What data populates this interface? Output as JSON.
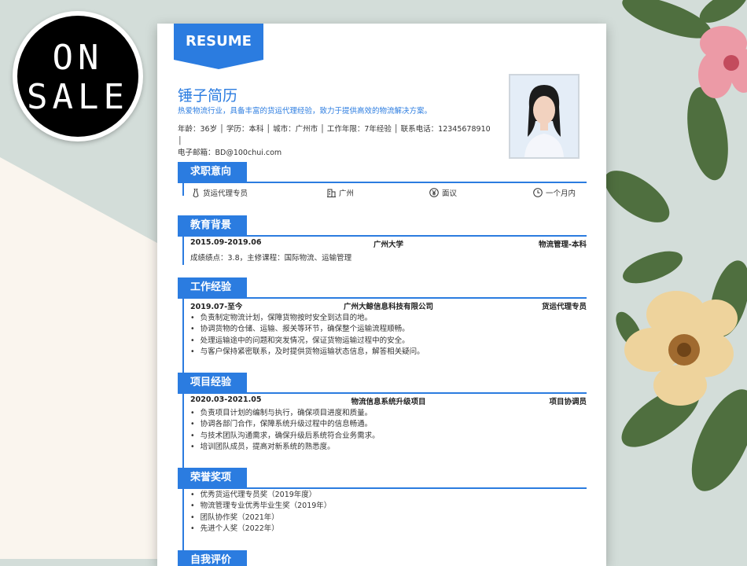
{
  "sale": {
    "line1": "ON",
    "line2": "SALE"
  },
  "resume": {
    "ribbon": "RESUME",
    "name": "锤子简历",
    "tagline": "热爱物流行业，具备丰富的货运代理经验，致力于提供高效的物流解决方案。",
    "info_line1": "年龄：36岁 │ 学历：本科 │ 城市：广州市 │ 工作年限：7年经验 │ 联系电话：12345678910 │",
    "info_line2": "电子邮箱：BD@100chui.com"
  },
  "sections": {
    "intent": {
      "title": "求职意向",
      "position": "货运代理专员",
      "city": "广州",
      "salary": "面议",
      "availability": "一个月内"
    },
    "education": {
      "title": "教育背景",
      "period": "2015.09-2019.06",
      "school": "广州大学",
      "major": "物流管理-本科",
      "detail": "成绩绩点：3.8，主修课程：国际物流、运输管理"
    },
    "work": {
      "title": "工作经验",
      "period": "2019.07-至今",
      "company": "广州大鲸信息科技有限公司",
      "role": "货运代理专员",
      "items": [
        "负责制定物流计划，保障货物按时安全到达目的地。",
        "协调货物的仓储、运输、报关等环节，确保整个运输流程顺畅。",
        "处理运输途中的问题和突发情况，保证货物运输过程中的安全。",
        "与客户保持紧密联系，及时提供货物运输状态信息，解答相关疑问。"
      ]
    },
    "project": {
      "title": "项目经验",
      "period": "2020.03-2021.05",
      "name": "物流信息系统升级项目",
      "role": "项目协调员",
      "items": [
        "负责项目计划的编制与执行，确保项目进度和质量。",
        "协调各部门合作，保障系统升级过程中的信息畅通。",
        "与技术团队沟通需求，确保升级后系统符合业务需求。",
        "培训团队成员，提高对新系统的熟悉度。"
      ]
    },
    "awards": {
      "title": "荣誉奖项",
      "items": [
        "优秀货运代理专员奖（2019年度）",
        "物流管理专业优秀毕业生奖（2019年）",
        "团队协作奖（2021年）",
        "先进个人奖（2022年）"
      ]
    },
    "self": {
      "title": "自我评价"
    }
  },
  "colors": {
    "accent": "#2b7ce0",
    "background": "#d3ddd9",
    "cream": "#faf5ee"
  }
}
